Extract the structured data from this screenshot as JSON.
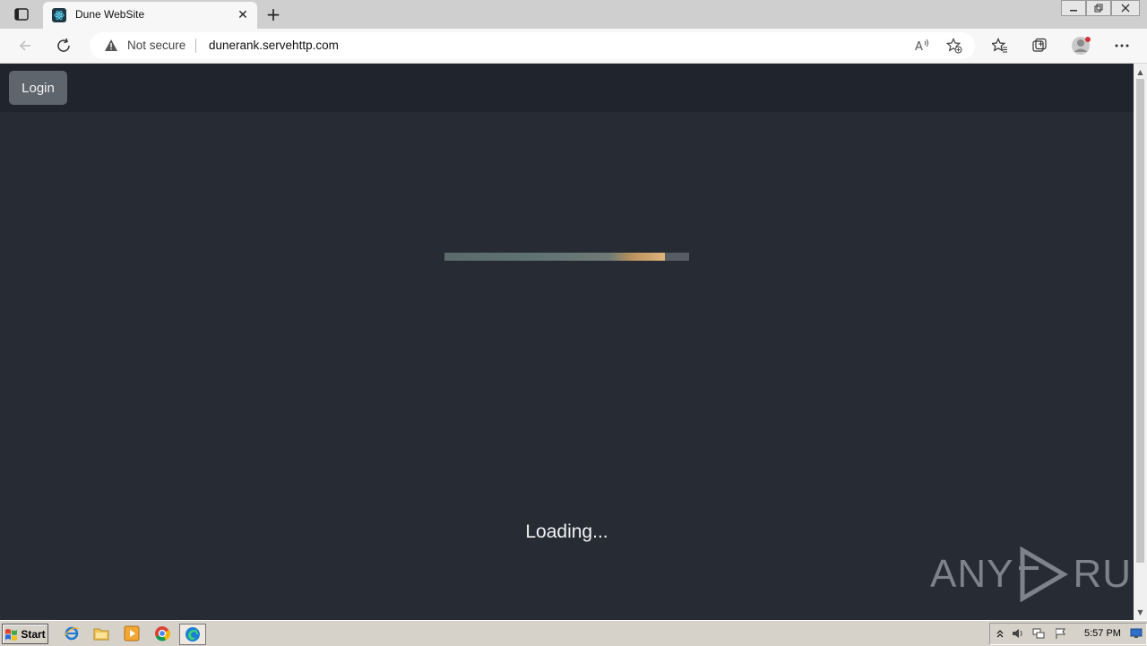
{
  "browser": {
    "tab_title": "Dune WebSite",
    "new_tab_symbol": "+",
    "close_tab_symbol": "✕",
    "security_label": "Not secure",
    "url": "dunerank.servehttp.com"
  },
  "page": {
    "login_label": "Login",
    "loading_text": "Loading...",
    "progress": 0.9,
    "watermark_left": "ANY",
    "watermark_right": "RUN"
  },
  "taskbar": {
    "start_label": "Start",
    "clock": "5:57 PM"
  },
  "colors": {
    "page_bg": "#262b34",
    "header_bg": "#20252d",
    "button_bg": "#5f656d"
  }
}
